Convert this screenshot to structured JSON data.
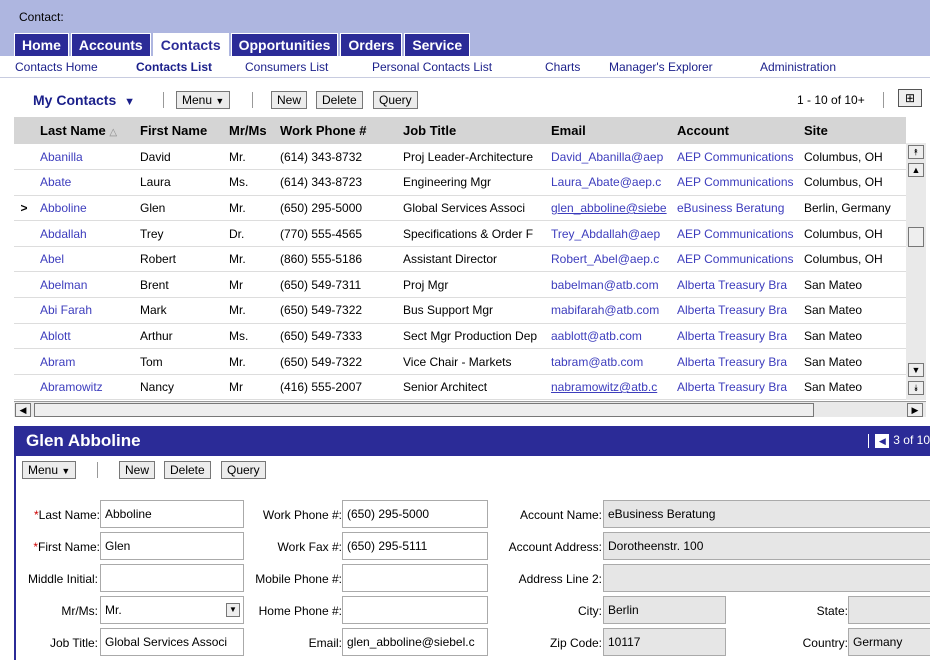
{
  "header": {
    "context_label": "Contact:",
    "tabs": [
      "Home",
      "Accounts",
      "Contacts",
      "Opportunities",
      "Orders",
      "Service"
    ],
    "subnav": [
      "Contacts Home",
      "Contacts List",
      "Consumers List",
      "Personal Contacts List",
      "Charts",
      "Manager's Explorer",
      "Administration"
    ]
  },
  "list": {
    "view_name": "My Contacts",
    "dropdown_glyph": "▼",
    "menu_label": "Menu",
    "new_label": "New",
    "delete_label": "Delete",
    "query_label": "Query",
    "pager_text": "1 - 10 of 10+",
    "columns": [
      "Last Name",
      "First Name",
      "Mr/Ms",
      "Work Phone #",
      "Job Title",
      "Email",
      "Account",
      "Site"
    ],
    "sort_indicator": "△",
    "selected_marker": ">",
    "rows": [
      [
        "Abanilla",
        "David",
        "Mr.",
        "(614) 343-8732",
        "Proj Leader-Architecture",
        "David_Abanilla@aep",
        "AEP Communications",
        "Columbus, OH"
      ],
      [
        "Abate",
        "Laura",
        "Ms.",
        "(614) 343-8723",
        "Engineering Mgr",
        "Laura_Abate@aep.c",
        "AEP Communications",
        "Columbus, OH"
      ],
      [
        "Abboline",
        "Glen",
        "Mr.",
        "(650) 295-5000",
        "Global Services Associ",
        "glen_abboline@siebe",
        "eBusiness Beratung",
        "Berlin, Germany"
      ],
      [
        "Abdallah",
        "Trey",
        "Dr.",
        "(770) 555-4565",
        "Specifications & Order F",
        "Trey_Abdallah@aep",
        "AEP Communications",
        "Columbus, OH"
      ],
      [
        "Abel",
        "Robert",
        "Mr.",
        "(860) 555-5186",
        "Assistant Director",
        "Robert_Abel@aep.c",
        "AEP Communications",
        "Columbus, OH"
      ],
      [
        "Abelman",
        "Brent",
        "Mr",
        "(650) 549-7311",
        "Proj Mgr",
        "babelman@atb.com",
        "Alberta Treasury Bra",
        "San Mateo"
      ],
      [
        "Abi Farah",
        "Mark",
        "Mr.",
        "(650) 549-7322",
        "Bus Support Mgr",
        "mabifarah@atb.com",
        "Alberta Treasury Bra",
        "San Mateo"
      ],
      [
        "Ablott",
        "Arthur",
        "Ms.",
        "(650) 549-7333",
        "Sect Mgr Production Dep",
        "aablott@atb.com",
        "Alberta Treasury Bra",
        "San Mateo"
      ],
      [
        "Abram",
        "Tom",
        "Mr.",
        "(650) 549-7322",
        "Vice Chair - Markets",
        "tabram@atb.com",
        "Alberta Treasury Bra",
        "San Mateo"
      ],
      [
        "Abramowitz",
        "Nancy",
        "Mr",
        "(416) 555-2007",
        "Senior Architect",
        "nabramowitz@atb.c",
        "Alberta Treasury Bra",
        "San Mateo"
      ]
    ],
    "selected_row_index": 2
  },
  "form": {
    "title": "Glen Abboline",
    "pager_text": "3 of 10",
    "menu_label": "Menu",
    "new_label": "New",
    "delete_label": "Delete",
    "query_label": "Query",
    "labels": {
      "last_name": "Last Name:",
      "first_name": "First Name:",
      "middle_initial": "Middle Initial:",
      "mr_ms": "Mr/Ms:",
      "job_title": "Job Title:",
      "work_phone": "Work Phone #:",
      "work_fax": "Work Fax #:",
      "mobile_phone": "Mobile Phone #:",
      "home_phone": "Home Phone #:",
      "email": "Email:",
      "account_name": "Account Name:",
      "account_address": "Account Address:",
      "address_line2": "Address Line 2:",
      "city": "City:",
      "zip": "Zip Code:",
      "state": "State:",
      "country": "Country:"
    },
    "values": {
      "last_name": "Abboline",
      "first_name": "Glen",
      "middle_initial": "",
      "mr_ms": "Mr.",
      "job_title": "Global Services Associ",
      "work_phone": "(650) 295-5000",
      "work_fax": "(650) 295-5111",
      "mobile_phone": "",
      "home_phone": "",
      "email": "glen_abboline@siebel.c",
      "account_name": "eBusiness Beratung",
      "account_address": "Dorotheenstr. 100",
      "address_line2": "",
      "city": "Berlin",
      "zip": "10117",
      "state": "",
      "country": "Germany"
    },
    "required_marker": "*"
  },
  "colors": {
    "header_bg": "#aeb6e0",
    "tab_bg": "#2b2b97",
    "link": "#3d3dbd",
    "form_header": "#2b2b97"
  }
}
